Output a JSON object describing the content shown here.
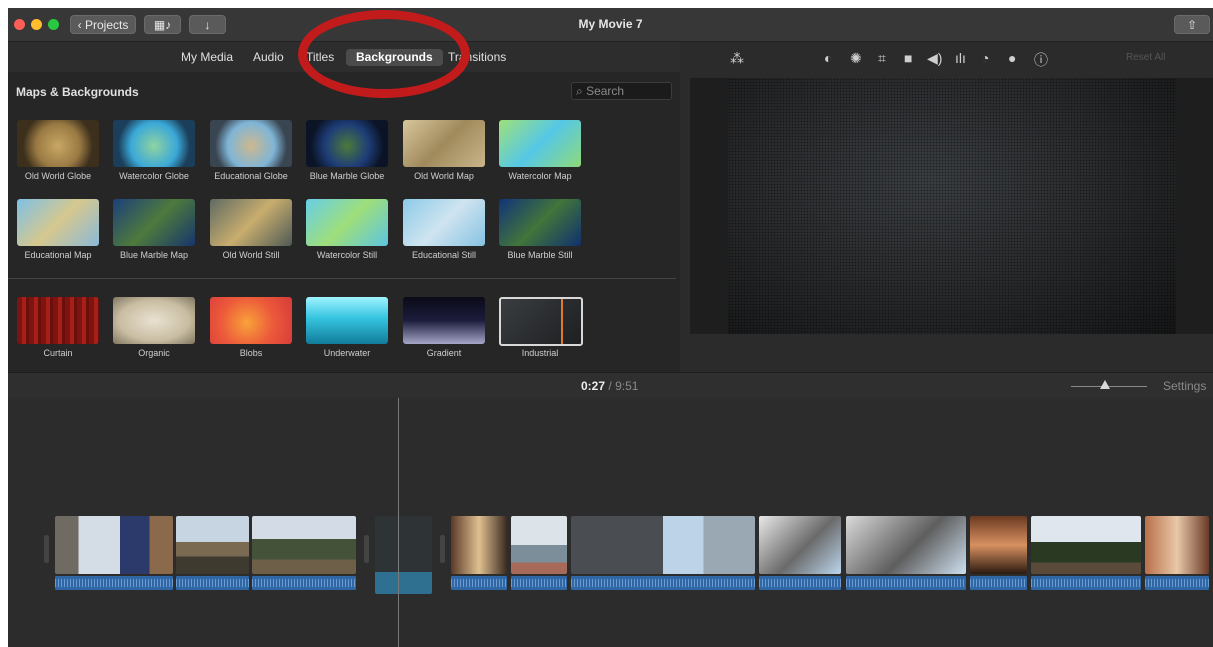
{
  "window": {
    "title": "My Movie 7"
  },
  "toolbar": {
    "projects_label": "Projects",
    "projects_icon": "chevron-left-icon",
    "media_icon": "film-music-icon",
    "import_icon": "down-arrow-icon",
    "share_icon": "share-icon"
  },
  "browser": {
    "tabs": [
      "My Media",
      "Audio",
      "Titles",
      "Backgrounds",
      "Transitions"
    ],
    "active_tab": "Backgrounds",
    "section_title": "Maps & Backgrounds",
    "search_placeholder": "Search",
    "maps": [
      "Old World Globe",
      "Watercolor Globe",
      "Educational Globe",
      "Blue Marble Globe",
      "Old World Map",
      "Watercolor Map",
      "Educational Map",
      "Blue Marble Map",
      "Old World Still",
      "Watercolor Still",
      "Educational Still",
      "Blue Marble Still"
    ],
    "backgrounds": [
      "Curtain",
      "Organic",
      "Blobs",
      "Underwater",
      "Gradient",
      "Industrial"
    ],
    "selected_background": "Industrial"
  },
  "viewer": {
    "tools": [
      "magic-wand-icon",
      "color-balance-icon",
      "palette-icon",
      "crop-icon",
      "camera-icon",
      "volume-icon",
      "equalizer-icon",
      "speed-icon",
      "filter-icon",
      "info-icon"
    ],
    "reset_label": "Reset All"
  },
  "timeline": {
    "current_time": "0:27",
    "separator": "/",
    "total_time": "9:51",
    "settings_label": "Settings",
    "zoom_level": 0.45
  }
}
